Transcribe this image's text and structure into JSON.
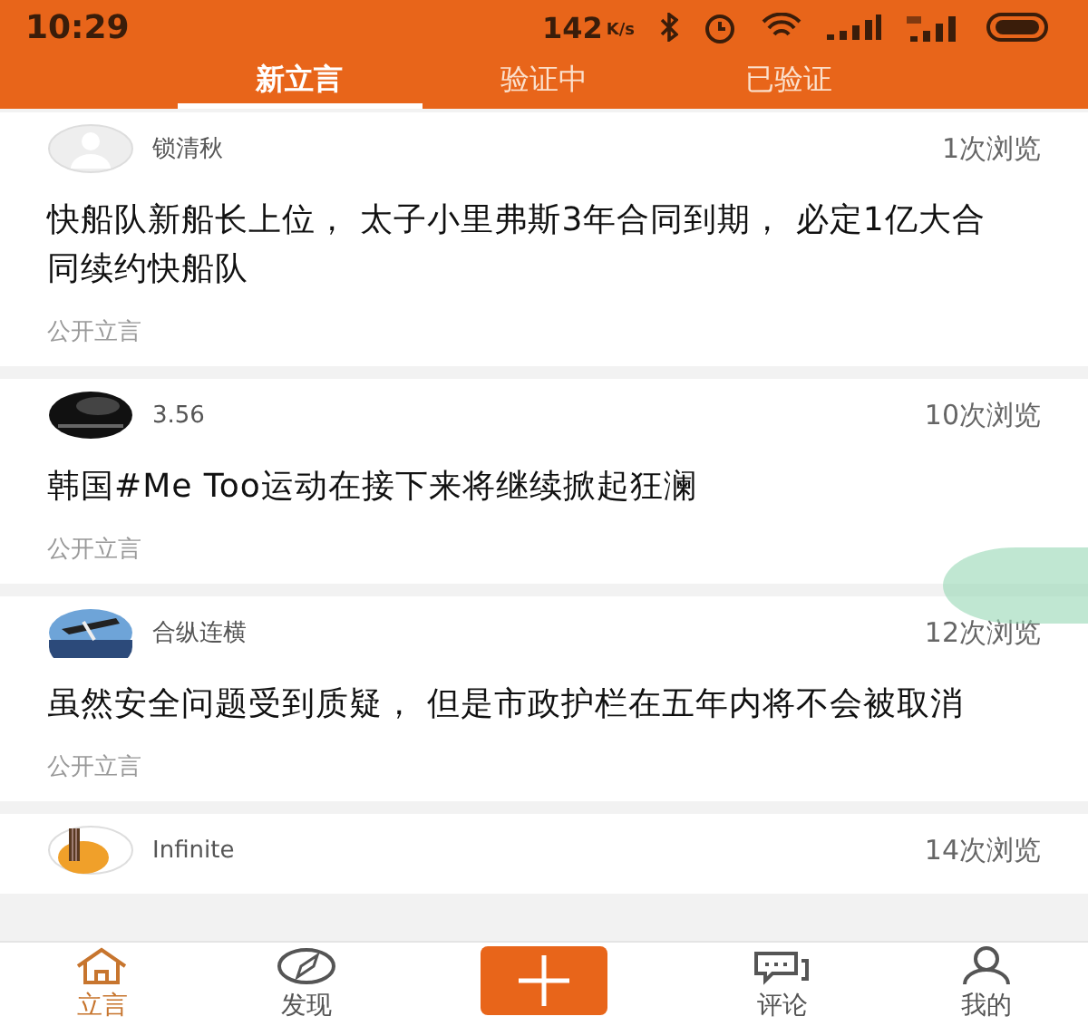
{
  "status_bar": {
    "time": "10:29",
    "speed": "142",
    "speed_unit": "K/s"
  },
  "tabs": [
    {
      "label": "新立言",
      "selected": true
    },
    {
      "label": "验证中",
      "selected": false
    },
    {
      "label": "已验证",
      "selected": false
    }
  ],
  "posts": [
    {
      "avatar": {
        "kind": "default"
      },
      "author": "锁清秋",
      "views": "1次浏览",
      "title": "快船队新船长上位， 太子小里弗斯3年合同到期， 必定1亿大合同续约快船队",
      "visibility": "公开立言"
    },
    {
      "author": "3.56",
      "views": "10次浏览",
      "title": "韩国#Me Too运动在接下来将继续掀起狂澜",
      "visibility": "公开立言"
    },
    {
      "author": "合纵连横",
      "views": "12次浏览",
      "title": "虽然安全问题受到质疑， 但是市政护栏在五年内将不会被取消",
      "visibility": "公开立言"
    },
    {
      "author": "Infinite",
      "views": "14次浏览"
    }
  ],
  "bottom_nav": [
    {
      "kind": "home",
      "label": "立言",
      "selected": true
    },
    {
      "kind": "compass",
      "label": "发现",
      "selected": false
    },
    {
      "kind": "add"
    },
    {
      "kind": "comment",
      "label": "评论",
      "selected": false
    },
    {
      "kind": "person",
      "label": "我的",
      "selected": false
    }
  ]
}
